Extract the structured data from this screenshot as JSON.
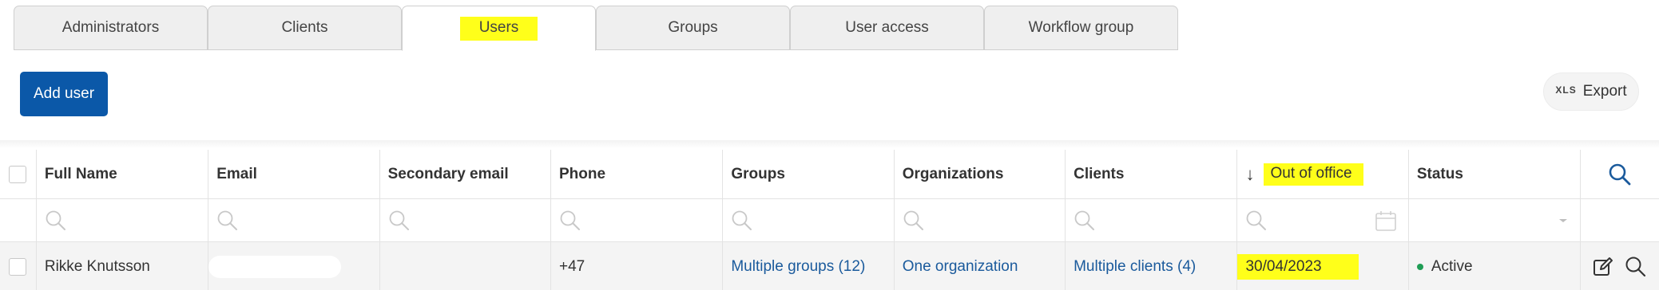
{
  "tabs": [
    {
      "label": "Administrators",
      "active": false
    },
    {
      "label": "Clients",
      "active": false
    },
    {
      "label": "Users",
      "active": true
    },
    {
      "label": "Groups",
      "active": false
    },
    {
      "label": "User access",
      "active": false
    },
    {
      "label": "Workflow group",
      "active": false
    }
  ],
  "toolbar": {
    "add_user_label": "Add user",
    "export_prefix": "XLS",
    "export_label": "Export"
  },
  "table": {
    "columns": [
      "Full Name",
      "Email",
      "Secondary email",
      "Phone",
      "Groups",
      "Organizations",
      "Clients",
      "Out of office",
      "Status"
    ],
    "sort_column": "Out of office",
    "sort_direction": "descending",
    "rows": [
      {
        "full_name": "Rikke Knutsson",
        "email": "",
        "secondary_email": "",
        "phone": "+47",
        "groups": "Multiple groups (12)",
        "organizations": "One organization",
        "clients": "Multiple clients (4)",
        "out_of_office": "30/04/2023",
        "status": "Active"
      }
    ]
  },
  "colors": {
    "accent": "#0b58a8",
    "link": "#1a5a9c",
    "highlight": "#ffff1a",
    "status_active": "#1f9d55"
  },
  "icons": [
    "search-icon",
    "calendar-icon",
    "chevron-down-icon",
    "edit-icon",
    "sort-desc-icon"
  ]
}
